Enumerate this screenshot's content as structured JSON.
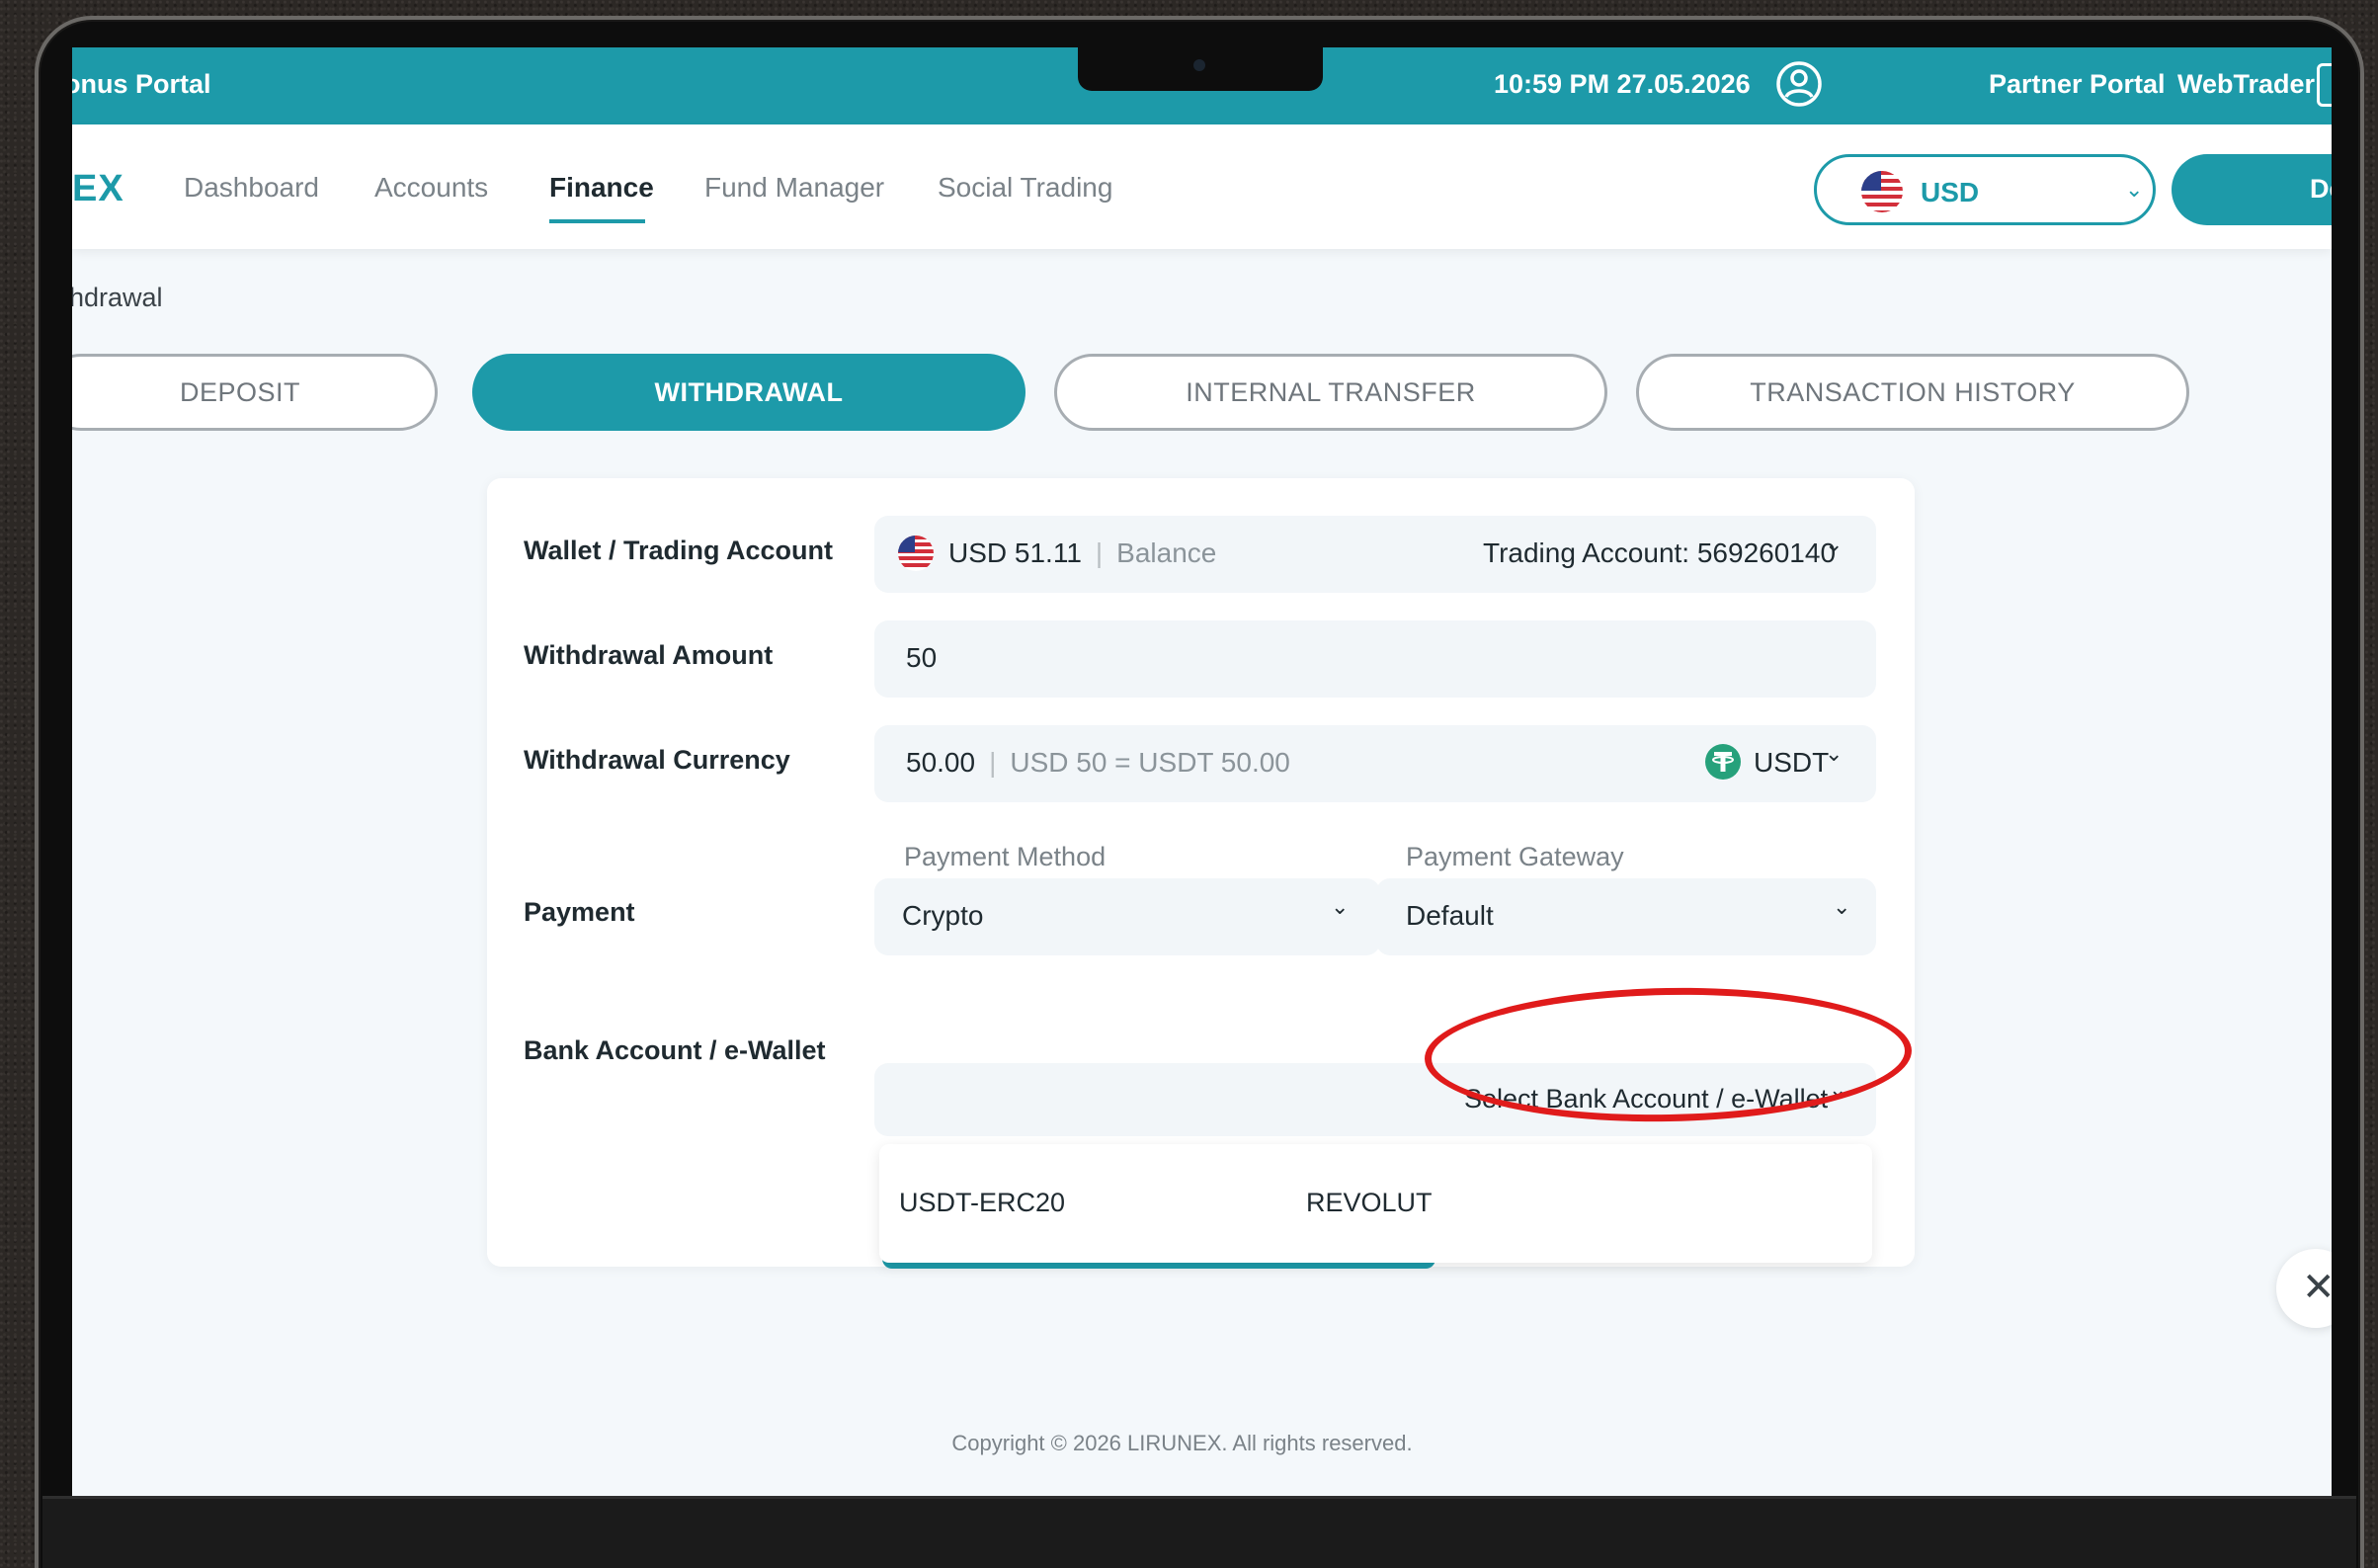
{
  "topbar": {
    "portal_label": "onus Portal",
    "datetime": "10:59 PM 27.05.2026",
    "partner_portal": "Partner Portal",
    "webtrader": "WebTrader"
  },
  "nav": {
    "logo": "EX",
    "items": [
      "Dashboard",
      "Accounts",
      "Finance",
      "Fund Manager",
      "Social Trading"
    ],
    "active": "Finance",
    "currency": "USD",
    "deposit_label": "De"
  },
  "breadcrumb": "hdrawal",
  "tabs": [
    "DEPOSIT",
    "WITHDRAWAL",
    "INTERNAL TRANSFER",
    "TRANSACTION HISTORY"
  ],
  "form": {
    "wallet": {
      "label": "Wallet / Trading Account",
      "amount": "USD 51.11",
      "balance_label": "Balance",
      "account": "Trading Account: 569260140"
    },
    "amount": {
      "label": "Withdrawal Amount",
      "value": "50"
    },
    "currency": {
      "label": "Withdrawal Currency",
      "value": "50.00",
      "conversion": "USD 50 = USDT 50.00",
      "code": "USDT"
    },
    "payment": {
      "label": "Payment",
      "method_label": "Payment Method",
      "method_value": "Crypto",
      "gateway_label": "Payment Gateway",
      "gateway_value": "Default"
    },
    "bank": {
      "label": "Bank Account / e-Wallet",
      "placeholder": "Select Bank Account / e-Wallet",
      "options": [
        "USDT-ERC20",
        "REVOLUT"
      ]
    }
  },
  "copyright": "Copyright © 2026 LIRUNEX. All rights reserved.",
  "colors": {
    "accent": "#1d9aa9",
    "highlight": "#e01b1b",
    "background": "#f4f8fb"
  }
}
